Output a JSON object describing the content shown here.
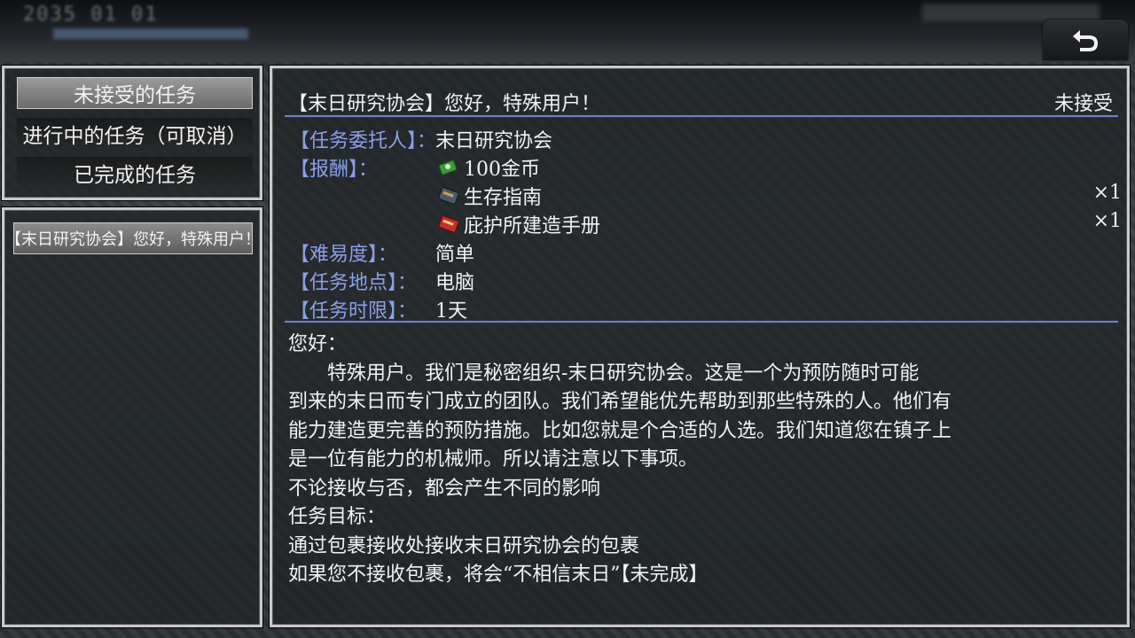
{
  "header": {
    "hud_text": "2035 01 01",
    "back_icon": "back-arrow-icon"
  },
  "categories": [
    {
      "label": "未接受的任务",
      "selected": true
    },
    {
      "label": "进行中的任务（可取消）",
      "selected": false
    },
    {
      "label": "已完成的任务",
      "selected": false
    }
  ],
  "quests": [
    {
      "label": "【末日研究协会】您好，特殊用户！"
    }
  ],
  "detail": {
    "title": "【末日研究协会】您好，特殊用户！",
    "status": "未接受",
    "client_label": "【任务委托人】：",
    "client_value": "末日研究协会",
    "reward_label": "【报酬】：",
    "rewards": [
      {
        "name": "100金币",
        "icon": "money-icon",
        "qty": ""
      },
      {
        "name": "生存指南",
        "icon": "book-icon",
        "qty": "×1"
      },
      {
        "name": "庇护所建造手册",
        "icon": "manual-icon",
        "qty": "×1"
      }
    ],
    "difficulty_label": "【难易度】：",
    "difficulty_value": "简单",
    "location_label": "【任务地点】：",
    "location_value": "电脑",
    "time_label": "【任务时限】：",
    "time_value": "1天",
    "description_lines": [
      "您好：",
      "　　特殊用户。我们是秘密组织-末日研究协会。这是一个为预防随时可能",
      "到来的末日而专门成立的团队。我们希望能优先帮助到那些特殊的人。他们有",
      "能力建造更完善的预防措施。比如您就是个合适的人选。我们知道您在镇子上",
      "是一位有能力的机械师。所以请注意以下事项。",
      "不论接收与否，都会产生不同的影响",
      "任务目标：",
      "通过包裹接收处接收末日研究协会的包裹",
      "如果您不接收包裹，将会“不相信末日”【未完成】"
    ]
  },
  "colors": {
    "label_blue": "#8aa0e8",
    "divider": "#6f80c8",
    "panel_border": "#c9c9c9"
  }
}
